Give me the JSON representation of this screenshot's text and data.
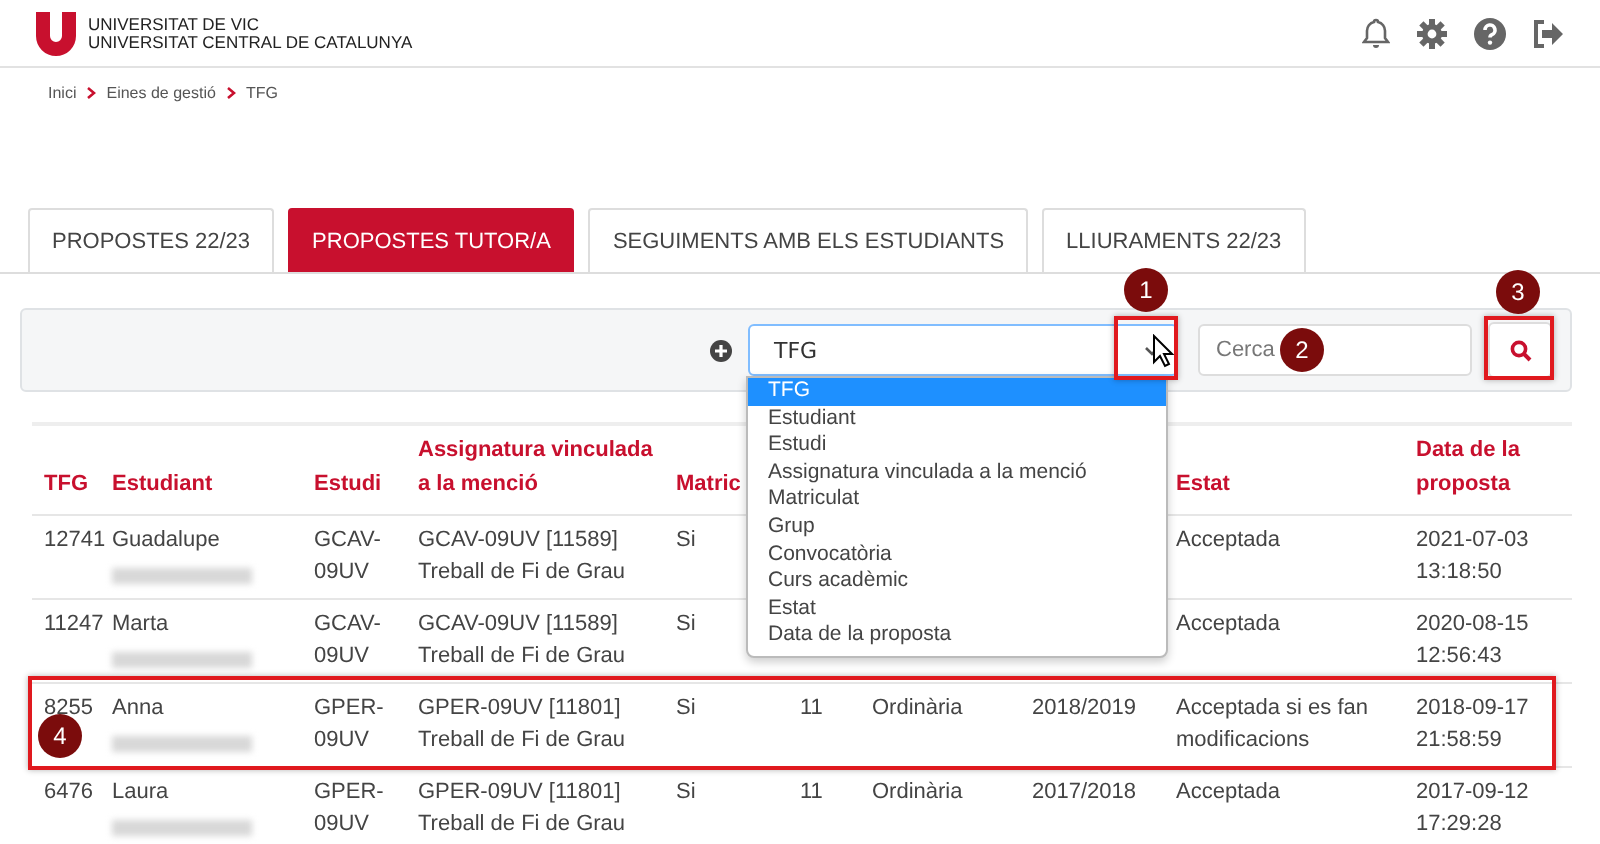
{
  "header": {
    "logo_line_1": "UNIVERSITAT DE VIC",
    "logo_line_2": "UNIVERSITAT CENTRAL DE CATALUNYA"
  },
  "breadcrumb": [
    "Inici",
    "Eines de gestió",
    "TFG"
  ],
  "tabs": [
    {
      "label": "PROPOSTES 22/23",
      "selected": false
    },
    {
      "label": "PROPOSTES TUTOR/A",
      "selected": true
    },
    {
      "label": "SEGUIMENTS AMB ELS ESTUDIANTS",
      "selected": false
    },
    {
      "label": "LLIURAMENTS 22/23",
      "selected": false
    }
  ],
  "filter": {
    "add_icon": true,
    "select_value": "TFG",
    "search_placeholder": "Cerca",
    "dropdown_options": [
      {
        "label": "TFG",
        "selected": true
      },
      {
        "label": "Estudiant",
        "selected": false
      },
      {
        "label": "Estudi",
        "selected": false
      },
      {
        "label": "Assignatura vinculada a la menció",
        "selected": false
      },
      {
        "label": "Matriculat",
        "selected": false
      },
      {
        "label": "Grup",
        "selected": false
      },
      {
        "label": "Convocatòria",
        "selected": false
      },
      {
        "label": "Curs acadèmic",
        "selected": false
      },
      {
        "label": "Estat",
        "selected": false
      },
      {
        "label": "Data de la proposta",
        "selected": false
      }
    ]
  },
  "table": {
    "headers": {
      "tfg": "TFG",
      "estudiant": "Estudiant",
      "estudi": "Estudi",
      "assignatura": "Assignatura vinculada a la menció",
      "matric": "Matric",
      "estat": "Estat",
      "data": "Data de la proposta"
    },
    "rows": [
      {
        "tfg": "12741",
        "estudiant": "Guadalupe",
        "estudi": "GCAV-09UV",
        "assignatura": "GCAV-09UV [11589] Treball de Fi de Grau",
        "matric": "Si",
        "estat": "Acceptada",
        "data": "2021-07-03 13:18:50",
        "surname_blurred": true,
        "highlighted": false
      },
      {
        "tfg": "11247",
        "estudiant": "Marta",
        "estudi": "GCAV-09UV",
        "assignatura": "GCAV-09UV [11589] Treball de Fi de Grau",
        "matric": "Si",
        "estat": "Acceptada",
        "data": "2020-08-15 12:56:43",
        "surname_blurred": true,
        "highlighted": false
      },
      {
        "tfg": "8255",
        "estudiant": "Anna",
        "estudi": "GPER-09UV",
        "assignatura": "GPER-09UV [11801] Treball de Fi de Grau",
        "matric": "Si",
        "column_6": "11",
        "column_7": "Ordinària",
        "column_8": "2018/2019",
        "estat": "Acceptada si es fan modificacions",
        "data": "2018-09-17 21:58:59",
        "surname_blurred": true,
        "highlighted": true
      },
      {
        "tfg": "6476",
        "estudiant": "Laura",
        "estudi": "GPER-09UV",
        "assignatura": "GPER-09UV [11801] Treball de Fi de Grau",
        "matric": "Si",
        "column_6": "11",
        "column_7": "Ordinària",
        "column_8": "2017/2018",
        "estat": "Acceptada",
        "data": "2017-09-12 17:29:28",
        "surname_blurred": true,
        "highlighted": false
      }
    ]
  },
  "annotations": [
    "1",
    "2",
    "3",
    "4"
  ]
}
